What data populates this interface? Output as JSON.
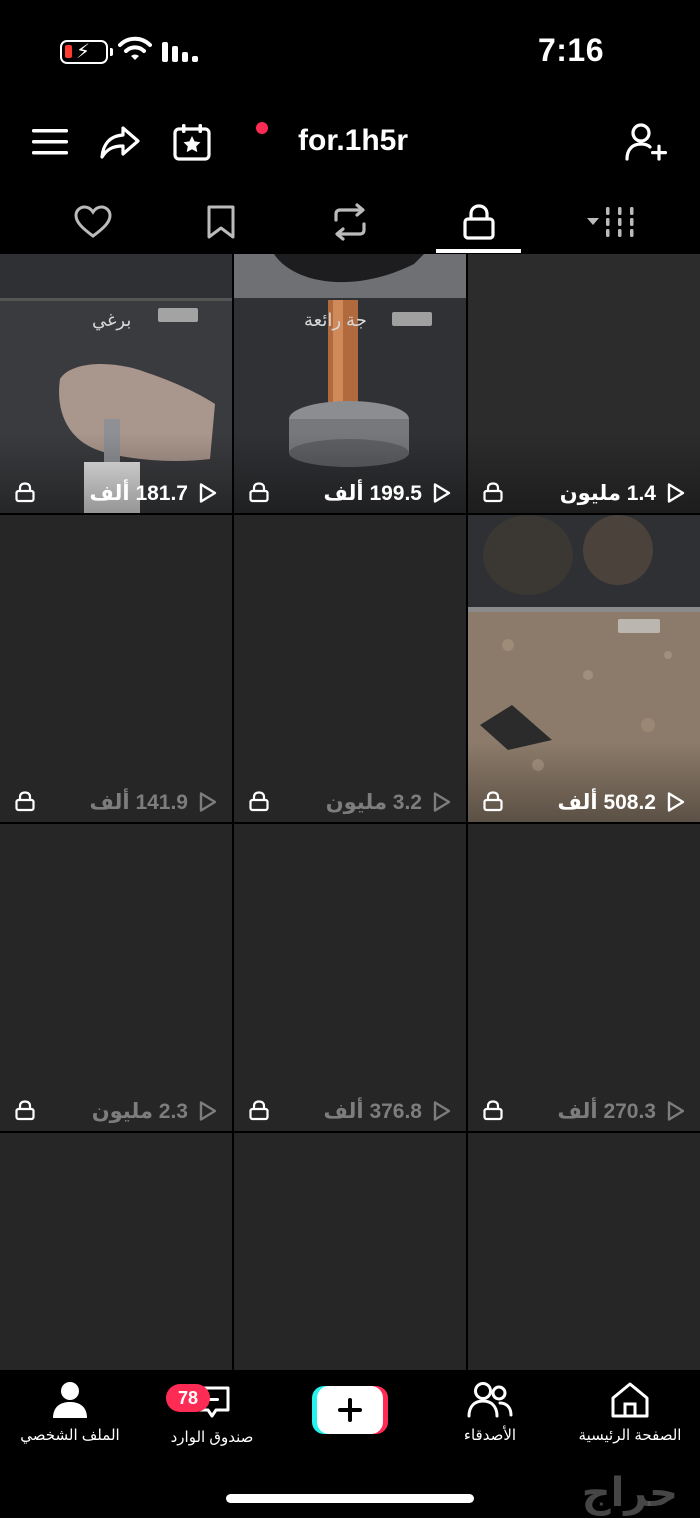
{
  "status_bar": {
    "time": "7:16"
  },
  "header": {
    "username": "for.1h5r"
  },
  "tabs": [
    {
      "id": "liked",
      "icon": "heart-icon"
    },
    {
      "id": "saved",
      "icon": "bookmark-icon"
    },
    {
      "id": "reposts",
      "icon": "repost-icon"
    },
    {
      "id": "private",
      "icon": "lock-icon",
      "selected": true
    },
    {
      "id": "filter",
      "icon": "filter-icon"
    }
  ],
  "grid": {
    "items": [
      {
        "views": "181.7 ألف",
        "caption": "برغي",
        "dim": false
      },
      {
        "views": "199.5 ألف",
        "caption": "جة رائعة",
        "dim": false
      },
      {
        "views": "1.4 مليون",
        "caption": "",
        "dim": false
      },
      {
        "views": "141.9 ألف",
        "caption": "",
        "dim": true
      },
      {
        "views": "3.2 مليون",
        "caption": "",
        "dim": true
      },
      {
        "views": "508.2 ألف",
        "caption": "",
        "dim": false
      },
      {
        "views": "2.3 مليون",
        "caption": "",
        "dim": true
      },
      {
        "views": "376.8 ألف",
        "caption": "",
        "dim": true
      },
      {
        "views": "270.3 ألف",
        "caption": "",
        "dim": true
      },
      {
        "views": "",
        "caption": "",
        "dim": true
      },
      {
        "views": "",
        "caption": "",
        "dim": true
      },
      {
        "views": "",
        "caption": "",
        "dim": true
      }
    ]
  },
  "bottom_nav": {
    "profile_label": "الملف الشخصي",
    "inbox_label": "صندوق الوارد",
    "inbox_badge": "78",
    "friends_label": "الأصدقاء",
    "home_label": "الصفحة الرئيسية"
  },
  "watermark": "حراج",
  "colors": {
    "accent": "#fe2c55",
    "cyan": "#25f4ee",
    "tile": "#262626"
  }
}
